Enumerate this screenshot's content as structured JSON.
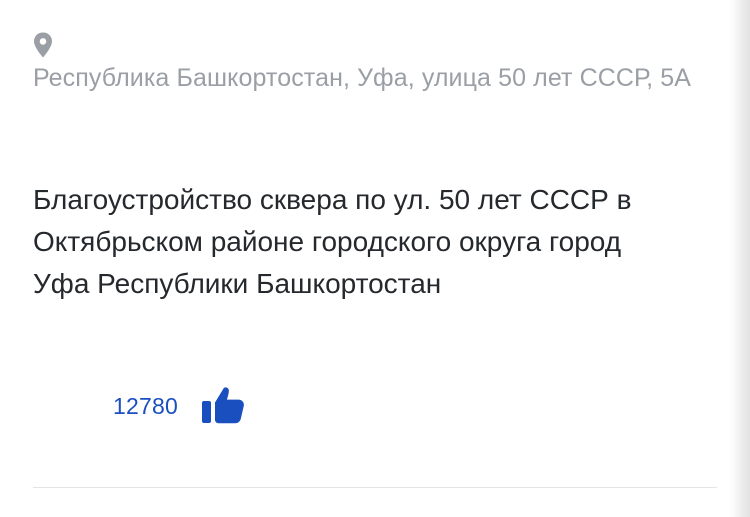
{
  "project": {
    "location_icon": "map-pin-icon",
    "address": "Республика Башкортостан, Уфа, улица 50 лет СССР, 5А",
    "title": "Благоустройство сквера по ул. 50 лет СССР в Октябрьском районе городского округа город Уфа Республики Башкортостан",
    "likes": {
      "count": "12780",
      "icon": "thumbs-up-icon"
    }
  },
  "colors": {
    "address_text": "#9a9ea5",
    "title_text": "#25282c",
    "accent": "#1a4fc0",
    "divider": "#e3e4e6"
  }
}
